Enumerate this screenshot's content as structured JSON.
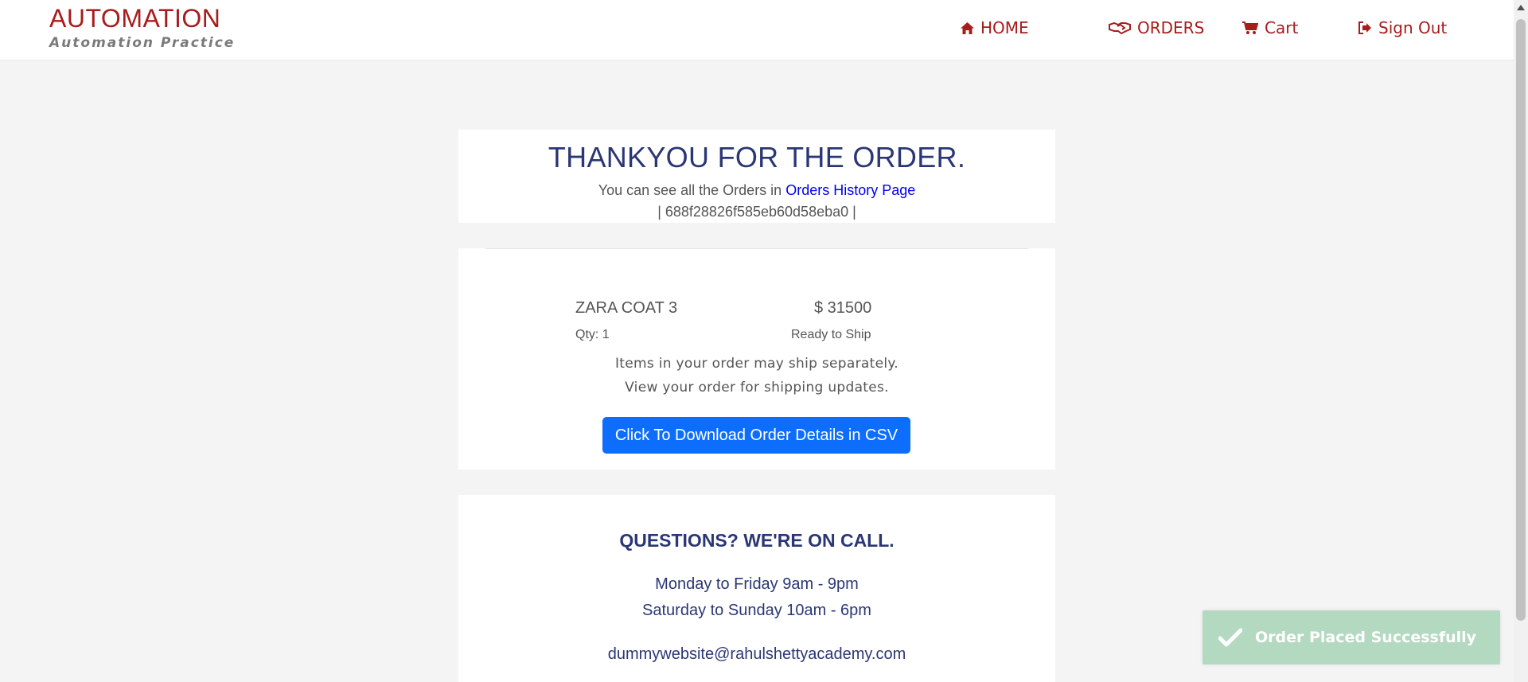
{
  "header": {
    "brand_title": "AUTOMATION",
    "brand_subtitle": "Automation Practice",
    "nav": {
      "home": "HOME",
      "orders": "ORDERS",
      "cart": "Cart",
      "sign_out": "Sign Out"
    }
  },
  "confirmation": {
    "title": "THANKYOU FOR THE ORDER.",
    "history_prefix": "You can see all the Orders in ",
    "history_link": "Orders History Page",
    "order_id": "| 688f28826f585eb60d58eba0 |"
  },
  "order": {
    "item_name": "ZARA COAT 3",
    "item_price": "$ 31500",
    "item_qty": "Qty: 1",
    "item_status": "Ready to Ship",
    "ship_note_1": "Items in your order may ship separately.",
    "ship_note_2": "View your order for shipping updates.",
    "csv_button": "Click To Download Order Details in CSV"
  },
  "contact": {
    "title": "QUESTIONS? WE'RE ON CALL.",
    "hours_weekday": "Monday to Friday 9am - 9pm",
    "hours_weekend": "Saturday to Sunday 10am - 6pm",
    "email": "dummywebsite@rahulshettyacademy.com"
  },
  "toast": {
    "message": "Order Placed Successfully",
    "icon": "check-icon"
  },
  "colors": {
    "brand": "#a81c1c",
    "heading": "#2b3775",
    "primary_button": "#0d6efd",
    "toast_bg": "#b3d9c0"
  }
}
